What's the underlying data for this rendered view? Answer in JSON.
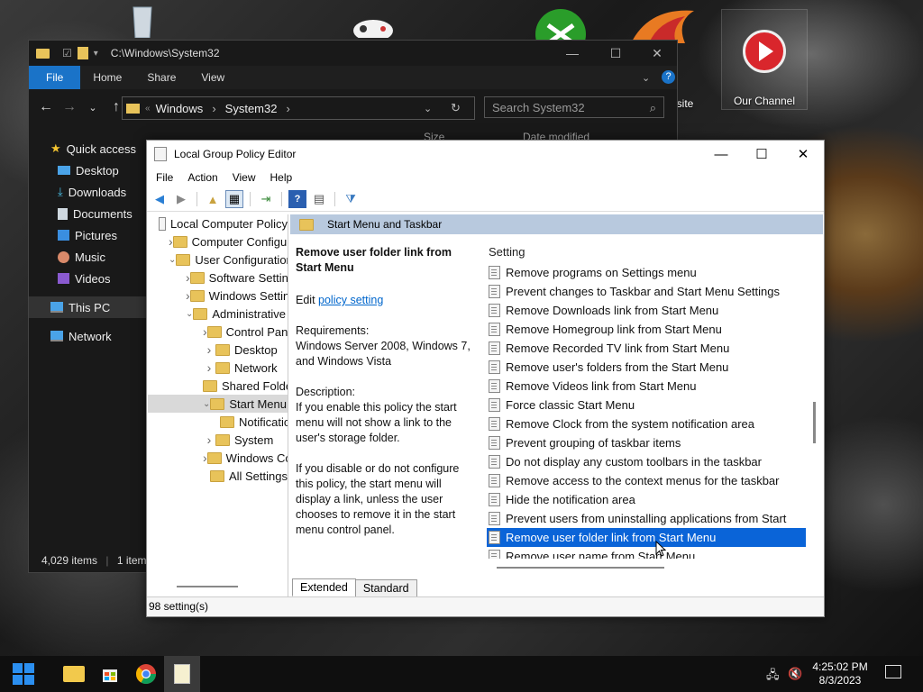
{
  "desktop": {
    "icon_labels": [
      "site",
      "Our Channel"
    ]
  },
  "explorer": {
    "path": "C:\\Windows\\System32",
    "ribbon_tabs": [
      "File",
      "Home",
      "Share",
      "View"
    ],
    "breadcrumb": [
      "Windows",
      "System32"
    ],
    "search_placeholder": "Search System32",
    "col_size": "Size",
    "col_date": "Date modified",
    "sidebar": [
      "Quick access",
      "Desktop",
      "Downloads",
      "Documents",
      "Pictures",
      "Music",
      "Videos",
      "This PC",
      "Network"
    ],
    "status_items": "4,029 items",
    "status_selected": "1 item"
  },
  "gpe": {
    "title": "Local Group Policy Editor",
    "menu": [
      "File",
      "Action",
      "View",
      "Help"
    ],
    "tree": [
      {
        "label": "Local Computer Policy",
        "indent": 0,
        "exp": ""
      },
      {
        "label": "Computer Configuration",
        "indent": 1,
        "exp": ">"
      },
      {
        "label": "User Configuration",
        "indent": 1,
        "exp": "v"
      },
      {
        "label": "Software Settings",
        "indent": 2,
        "exp": ">"
      },
      {
        "label": "Windows Settings",
        "indent": 2,
        "exp": ">"
      },
      {
        "label": "Administrative Templates",
        "indent": 2,
        "exp": "v"
      },
      {
        "label": "Control Panel",
        "indent": 3,
        "exp": ">"
      },
      {
        "label": "Desktop",
        "indent": 3,
        "exp": ">"
      },
      {
        "label": "Network",
        "indent": 3,
        "exp": ">"
      },
      {
        "label": "Shared Folders",
        "indent": 3,
        "exp": ""
      },
      {
        "label": "Start Menu and Taskbar",
        "indent": 3,
        "exp": "v",
        "selected": true
      },
      {
        "label": "Notifications",
        "indent": 4,
        "exp": ""
      },
      {
        "label": "System",
        "indent": 3,
        "exp": ">"
      },
      {
        "label": "Windows Components",
        "indent": 3,
        "exp": ">"
      },
      {
        "label": "All Settings",
        "indent": 3,
        "exp": ""
      }
    ],
    "right_header": "Start Menu and Taskbar",
    "desc": {
      "title": "Remove user folder link from Start Menu",
      "edit_prefix": "Edit ",
      "edit_link": "policy setting",
      "req_label": "Requirements:",
      "req_text": "Windows Server 2008, Windows 7, and Windows Vista",
      "desc_label": "Description:",
      "desc_p1": "If you enable this policy the start menu will not show a link to the user's storage folder.",
      "desc_p2": "If you disable or do not configure this policy, the start menu will display a link, unless the user chooses to remove it in the start menu control panel."
    },
    "settings_header": "Setting",
    "settings": [
      "Remove programs on Settings menu",
      "Prevent changes to Taskbar and Start Menu Settings",
      "Remove Downloads link from Start Menu",
      "Remove Homegroup link from Start Menu",
      "Remove Recorded TV link from Start Menu",
      "Remove user's folders from the Start Menu",
      "Remove Videos link from Start Menu",
      "Force classic Start Menu",
      "Remove Clock from the system notification area",
      "Prevent grouping of taskbar items",
      "Do not display any custom toolbars in the taskbar",
      "Remove access to the context menus for the taskbar",
      "Hide the notification area",
      "Prevent users from uninstalling applications from Start",
      "Remove user folder link from Start Menu",
      "Remove user name from Start Menu"
    ],
    "selected_index": 14,
    "tabs": [
      "Extended",
      "Standard"
    ],
    "status": "98 setting(s)"
  },
  "taskbar": {
    "time": "4:25:02 PM",
    "date": "8/3/2023"
  },
  "colors": {
    "accent": "#1a73c8",
    "selection": "#0a64d8",
    "header_band": "#b8c9de"
  }
}
